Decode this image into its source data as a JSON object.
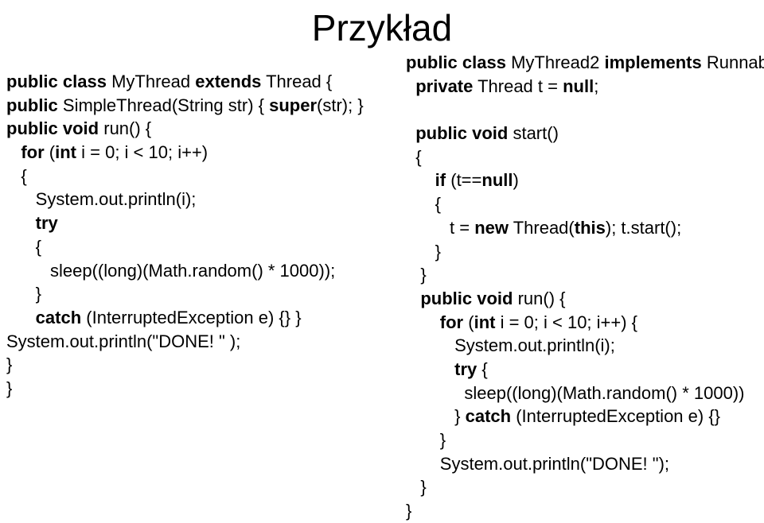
{
  "title": "Przykład",
  "left": {
    "l1a": "public class",
    "l1b": " MyThread ",
    "l1c": "extends",
    "l1d": " Thread {",
    "l2a": "public",
    "l2b": " SimpleThread(String str) { ",
    "l2c": "super",
    "l2d": "(str); }",
    "l3a": "public void",
    "l3b": " run() {",
    "l4a": "   for",
    "l4b": " (",
    "l4c": "int",
    "l4d": " i = 0; i < 10; i++)",
    "l5": "   {",
    "l6": "      System.out.println(i);",
    "l7a": "      try",
    "l8": "      {",
    "l9": "         sleep((long)(Math.random() * 1000));",
    "l10": "      }",
    "l11a": "      catch",
    "l11b": " (InterruptedException e) {} }",
    "l12": "System.out.println(\"DONE! \" );",
    "l13": "}",
    "l14": "}"
  },
  "right": {
    "r1a": "public class",
    "r1b": " MyThread2 ",
    "r1c": "implements",
    "r1d": " Runnab",
    "r2a": "  private",
    "r2b": " Thread t = ",
    "r2c": "null",
    "r2d": ";",
    "blank1": " ",
    "r3a": "  public void",
    "r3b": " start()",
    "r4": "  {",
    "r5a": "      if",
    "r5b": " (t==",
    "r5c": "null",
    "r5d": ")",
    "r6": "      {",
    "r7a": "         t = ",
    "r7b": "new",
    "r7c": " Thread(",
    "r7d": "this",
    "r7e": "); t.start();",
    "r8": "      }",
    "r9": "   }",
    "r10a": "   public void",
    "r10b": " run() {",
    "r11a": "       for",
    "r11b": " (",
    "r11c": "int",
    "r11d": " i = 0; i < 10; i++) {",
    "r12": "          System.out.println(i);",
    "r13a": "          try",
    "r13b": " {",
    "r14": "            sleep((long)(Math.random() * 1000))",
    "r15a": "          } ",
    "r15b": "catch",
    "r15c": " (InterruptedException e) {}",
    "r16": "       }",
    "r17": "       System.out.println(\"DONE! \");",
    "r18": "   }",
    "r19": "}"
  }
}
